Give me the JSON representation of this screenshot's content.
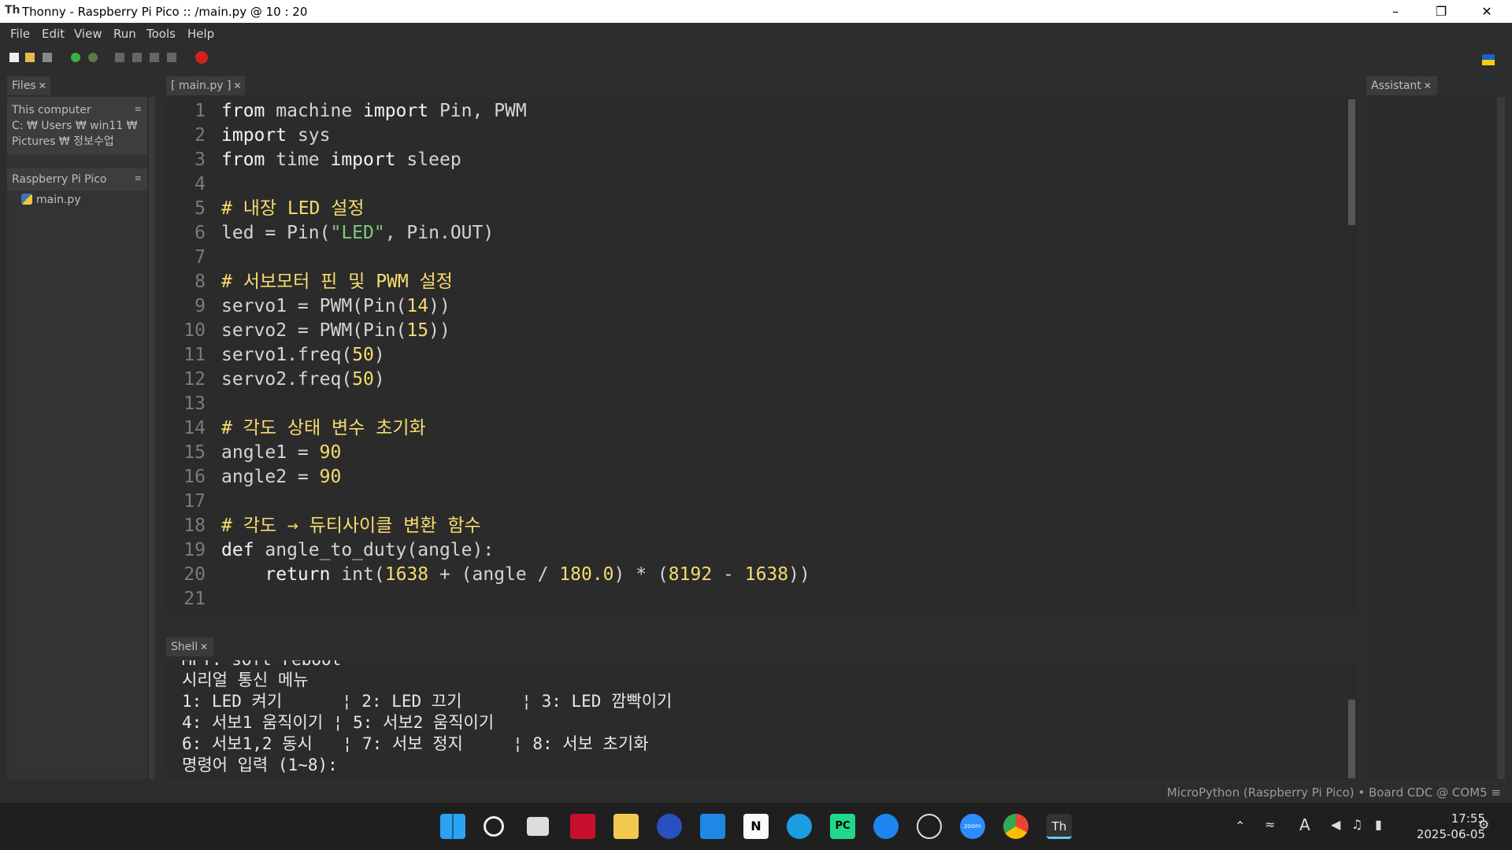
{
  "window": {
    "title": "Thonny  -  Raspberry Pi Pico :: /main.py  @  10 : 20"
  },
  "menu": [
    "File",
    "Edit",
    "View",
    "Run",
    "Tools",
    "Help"
  ],
  "files_panel": {
    "tab": "Files",
    "computer_label": "This computer",
    "path": [
      "C: ₩ Users ₩ win11 ₩",
      "Pictures ₩ 정보수업"
    ],
    "device_label": "Raspberry Pi Pico",
    "device_files": [
      "main.py"
    ]
  },
  "editor": {
    "tab": "[ main.py ]",
    "lines": [
      [
        {
          "t": "from",
          "c": "kw"
        },
        {
          "t": " machine ",
          "c": ""
        },
        {
          "t": "import",
          "c": "kw"
        },
        {
          "t": " Pin, PWM",
          "c": ""
        }
      ],
      [
        {
          "t": "import",
          "c": "kw"
        },
        {
          "t": " sys",
          "c": ""
        }
      ],
      [
        {
          "t": "from",
          "c": "kw"
        },
        {
          "t": " time ",
          "c": ""
        },
        {
          "t": "import",
          "c": "kw"
        },
        {
          "t": " sleep",
          "c": ""
        }
      ],
      [],
      [
        {
          "t": "# 내장 LED 설정",
          "c": "cmt"
        }
      ],
      [
        {
          "t": "led = Pin(",
          "c": ""
        },
        {
          "t": "\"LED\"",
          "c": "str"
        },
        {
          "t": ", Pin.OUT)",
          "c": ""
        }
      ],
      [],
      [
        {
          "t": "# 서보모터 핀 및 PWM 설정",
          "c": "cmt"
        }
      ],
      [
        {
          "t": "servo1 = PWM(Pin(",
          "c": ""
        },
        {
          "t": "14",
          "c": "num"
        },
        {
          "t": "))",
          "c": ""
        }
      ],
      [
        {
          "t": "servo2 = PWM(Pin(",
          "c": ""
        },
        {
          "t": "15",
          "c": "num"
        },
        {
          "t": "))",
          "c": ""
        }
      ],
      [
        {
          "t": "servo1.freq(",
          "c": ""
        },
        {
          "t": "50",
          "c": "num"
        },
        {
          "t": ")",
          "c": ""
        }
      ],
      [
        {
          "t": "servo2.freq(",
          "c": ""
        },
        {
          "t": "50",
          "c": "num"
        },
        {
          "t": ")",
          "c": ""
        }
      ],
      [],
      [
        {
          "t": "# 각도 상태 변수 초기화",
          "c": "cmt"
        }
      ],
      [
        {
          "t": "angle1 = ",
          "c": ""
        },
        {
          "t": "90",
          "c": "num"
        }
      ],
      [
        {
          "t": "angle2 = ",
          "c": ""
        },
        {
          "t": "90",
          "c": "num"
        }
      ],
      [],
      [
        {
          "t": "# 각도 → 듀티사이클 변환 함수",
          "c": "cmt"
        }
      ],
      [
        {
          "t": "def",
          "c": "kw"
        },
        {
          "t": " angle_to_duty(angle):",
          "c": ""
        }
      ],
      [
        {
          "t": "    ",
          "c": ""
        },
        {
          "t": "return",
          "c": "kw"
        },
        {
          "t": " int(",
          "c": ""
        },
        {
          "t": "1638",
          "c": "num"
        },
        {
          "t": " + (angle / ",
          "c": ""
        },
        {
          "t": "180.0",
          "c": "num"
        },
        {
          "t": ") * (",
          "c": ""
        },
        {
          "t": "8192",
          "c": "num"
        },
        {
          "t": " - ",
          "c": ""
        },
        {
          "t": "1638",
          "c": "num"
        },
        {
          "t": "))",
          "c": ""
        }
      ],
      []
    ]
  },
  "assistant_panel": {
    "tab": "Assistant"
  },
  "shell": {
    "tab": "Shell",
    "lines": [
      "MPY: soft reboot",
      "시리얼 통신 메뉴",
      "1: LED 켜기      ¦ 2: LED 끄기      ¦ 3: LED 깜빡이기",
      "4: 서보1 움직이기 ¦ 5: 서보2 움직이기",
      "6: 서보1,2 동시   ¦ 7: 서보 정지     ¦ 8: 서보 초기화",
      "명령어 입력 (1~8):"
    ]
  },
  "status": {
    "interpreter": "MicroPython (Raspberry Pi Pico)  •  Board CDC @ COM5  ≡"
  },
  "taskbar": {
    "clock_time": "17:55",
    "clock_date": "2025-06-05",
    "ime": "A",
    "apps": [
      "windows-icon",
      "search-icon",
      "task-view-icon",
      "acrobat-icon",
      "file-explorer-icon",
      "app-icon",
      "vscode-icon",
      "notion-icon",
      "edge-icon",
      "pycharm-icon",
      "app-store-icon",
      "obs-icon",
      "zoom-icon",
      "chrome-icon",
      "thonny-icon"
    ],
    "zoom_label": "zoom",
    "pycharm_label": "PC",
    "notion_label": "N",
    "thonny_label": "Th"
  },
  "colors": {
    "comment": "#f6dc6e",
    "number": "#f6dc6e",
    "string": "#7fc97f",
    "keyword": "#f2f2f2",
    "text": "#d4d4d4",
    "editor_bg": "#2b2b2b"
  }
}
